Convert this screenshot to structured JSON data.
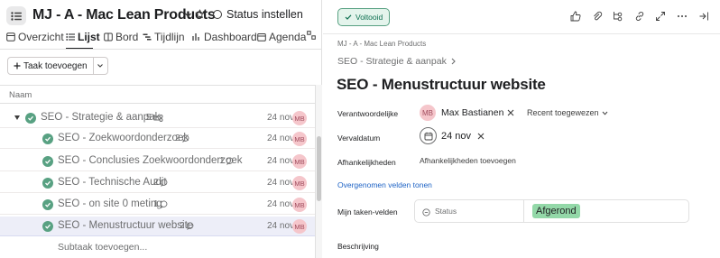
{
  "project": {
    "title": "MJ - A - Mac Lean Products",
    "status_label": "Status instellen"
  },
  "tabs": [
    {
      "label": "Overzicht",
      "icon": "overview-icon"
    },
    {
      "label": "Lijst",
      "icon": "list-icon"
    },
    {
      "label": "Bord",
      "icon": "board-icon"
    },
    {
      "label": "Tijdlijn",
      "icon": "timeline-icon"
    },
    {
      "label": "Dashboard",
      "icon": "dashboard-icon"
    },
    {
      "label": "Agenda",
      "icon": "calendar-icon"
    }
  ],
  "active_tab": "Lijst",
  "toolbar": {
    "add_task_label": "Taak toevoegen"
  },
  "list": {
    "column_name": "Naam",
    "parent": {
      "name": "SEO - Strategie & aanpak",
      "subtask_count": "5",
      "date": "24 nov",
      "assignee": "MB"
    },
    "subtasks": [
      {
        "name": "SEO - Zoekwoordonderzoek",
        "comments": "2",
        "date": "24 nov",
        "assignee": "MB",
        "completed": true,
        "selected": false
      },
      {
        "name": "SEO - Conclusies Zoekwoordonderzoek",
        "comments": "1",
        "date": "24 nov",
        "assignee": "MB",
        "completed": true,
        "selected": false
      },
      {
        "name": "SEO - Technische Audit",
        "comments": "2",
        "date": "24 nov",
        "assignee": "MB",
        "completed": true,
        "selected": false
      },
      {
        "name": "SEO - on site 0 meting",
        "comments": "1",
        "date": "24 nov",
        "assignee": "MB",
        "completed": true,
        "selected": false
      },
      {
        "name": "SEO - Menustructuur website",
        "comments": "2",
        "date": "24 nov",
        "assignee": "MB",
        "completed": true,
        "selected": true
      }
    ],
    "add_subtask_label": "Subtaak toevoegen..."
  },
  "detail": {
    "completed_label": "Voltooid",
    "breadcrumb_project": "MJ - A - Mac Lean Products",
    "breadcrumb_parent": "SEO - Strategie & aanpak",
    "title": "SEO - Menustructuur website",
    "assignee_label": "Verantwoordelijke",
    "assignee_initials": "MB",
    "assignee_name": "Max Bastianen",
    "recent_label": "Recent toegewezen",
    "due_label": "Vervaldatum",
    "due_date": "24 nov",
    "deps_label": "Afhankelijkheden",
    "deps_action": "Afhankelijkheden toevoegen",
    "inherited_fields": "Overgenomen velden tonen",
    "my_fields_label": "Mijn taken-velden",
    "status_field_label": "Status",
    "status_value": "Afgerond",
    "description_label": "Beschrijving"
  },
  "colors": {
    "accent_green": "#58a182",
    "status_green": "#93d8a8",
    "selected_row": "#edeef8",
    "avatar_pink": "#f5c6cb",
    "link_blue": "#1e63c5"
  }
}
